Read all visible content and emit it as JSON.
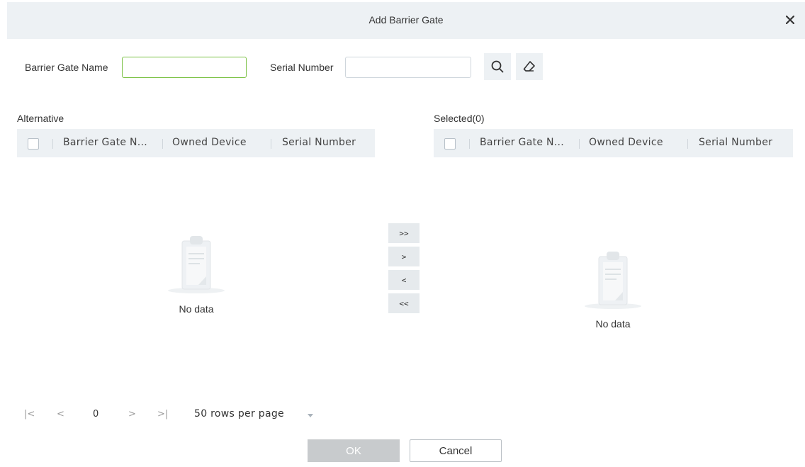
{
  "dialog": {
    "title": "Add Barrier Gate"
  },
  "search": {
    "name_label": "Barrier Gate Name",
    "name_value": "",
    "serial_label": "Serial Number",
    "serial_value": "",
    "search_icon": "search-icon",
    "clear_icon": "eraser-icon"
  },
  "alternative": {
    "label": "Alternative",
    "columns": [
      "Barrier Gate N...",
      "Owned Device",
      "Serial Number"
    ],
    "empty_text": "No data"
  },
  "selected": {
    "label": "Selected(0)",
    "columns": [
      "Barrier Gate N...",
      "Owned Device",
      "Serial Number"
    ],
    "empty_text": "No data"
  },
  "transfer": {
    "all_right": ">>",
    "right": ">",
    "left": "<",
    "all_left": "<<"
  },
  "pagination": {
    "first": "|<",
    "prev": "<",
    "page": "0",
    "next": ">",
    "last": ">|",
    "rows_per_page": "50 rows per page"
  },
  "footer": {
    "ok": "OK",
    "cancel": "Cancel"
  },
  "colors": {
    "header_bg": "#edf1f4",
    "focus_border": "#7ac143",
    "ok_disabled": "#c8cbcd"
  }
}
